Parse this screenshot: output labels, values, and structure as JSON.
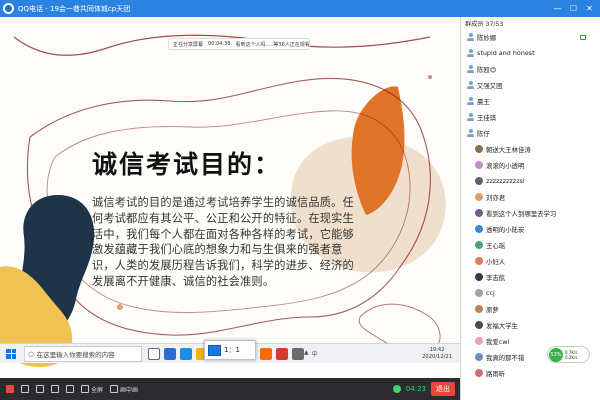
{
  "window": {
    "title": "QQ电话 - 19会一巷共同体城cp天团",
    "minimize": "—",
    "maximize": "☐",
    "close": "✕"
  },
  "share_bar": {
    "status": "正在分享屏幕",
    "elapsed": "00:04:38",
    "viewers": "看到这个人吗.....等36人正在观看"
  },
  "slide": {
    "title": "诚信考试目的：",
    "body": "诚信考试的目的是通过考试培养学生的诚信品质。任何考试都应有其公平、公正和公开的特征。在现实生活中，我们每个人都在面对各种各样的考试，它能够激发蕴藏于我们心底的想象力和与生俱来的强者意识，人类的发展历程告诉我们，科学的进步、经济的发展离不开健康、诚信的社会准则。"
  },
  "taskbar": {
    "search_placeholder": "在这里输入你要搜索的内容",
    "dialog_label": "1：1",
    "ime": "中",
    "time": "19:42",
    "date": "2020/12/21",
    "icon_colors": [
      "#ffffff",
      "#2f6bd6",
      "#1b8fe0",
      "#f5b400",
      "#e04a3b",
      "#35a853",
      "#2a83e0",
      "#ff6a00",
      "#d23b2f",
      "#6b6b6b"
    ]
  },
  "bottombar": {
    "fullscreen": "全屏",
    "pip": "画中画",
    "timer": "04:23",
    "exit": "退出"
  },
  "panel": {
    "header": "群成员 37/53",
    "members": [
      {
        "name": "陈妙娜",
        "type": "person",
        "mic": true
      },
      {
        "name": "stupid and honest",
        "type": "person"
      },
      {
        "name": "陈殴😊",
        "type": "person"
      },
      {
        "name": "又强又困",
        "type": "person"
      },
      {
        "name": "晨王",
        "type": "person"
      },
      {
        "name": "王佳琪",
        "type": "person"
      },
      {
        "name": "陈仔",
        "type": "person"
      },
      {
        "name": "朝送大王林佳涛",
        "type": "avatar",
        "color": "#8b6f4e"
      },
      {
        "name": "滚滚的小透明",
        "type": "avatar",
        "color": "#c08fc7"
      },
      {
        "name": "zzzzzzzzzzsl",
        "type": "avatar",
        "color": "#556677"
      },
      {
        "name": "刘亦君",
        "type": "avatar",
        "color": "#d9a066"
      },
      {
        "name": "看到这个人到哪里去学习",
        "type": "avatar",
        "color": "#7a5a8c"
      },
      {
        "name": "透明的小陆炭",
        "type": "avatar",
        "color": "#3d8bd6"
      },
      {
        "name": "王心瑶",
        "type": "avatar",
        "color": "#4aa56e"
      },
      {
        "name": "小妇人",
        "type": "avatar",
        "color": "#e07a5f"
      },
      {
        "name": "李志航",
        "type": "avatar",
        "color": "#2c3e50"
      },
      {
        "name": "ccj",
        "type": "avatar",
        "color": "#9aa3ad"
      },
      {
        "name": "原萝",
        "type": "avatar",
        "color": "#b5835a"
      },
      {
        "name": "发福大学生",
        "type": "avatar",
        "color": "#444c56"
      },
      {
        "name": "我爱cwl",
        "type": "avatar",
        "color": "#e8a2b8"
      },
      {
        "name": "我真的那不错",
        "type": "avatar",
        "color": "#6c8ebf"
      },
      {
        "name": "路雨昕",
        "type": "avatar",
        "color": "#cf6b6b"
      }
    ]
  },
  "speed": {
    "percent": "53%",
    "up": "0.7K/s",
    "down": "0.2K/s"
  },
  "colors": {
    "titlebar": "#2a83e0",
    "orange_blob": "#e0752a",
    "navy_blob": "#1f3349",
    "yellow_blob": "#f0c254",
    "beige_blob": "#eee0cc",
    "exit": "#e8453c"
  }
}
